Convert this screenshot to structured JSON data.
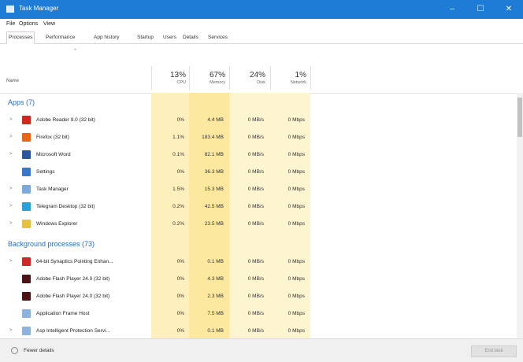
{
  "window": {
    "title": "Task Manager",
    "minimize": "–",
    "maximize": "☐",
    "close": "✕"
  },
  "menu": [
    "File",
    "Options",
    "View"
  ],
  "tabs": [
    "Processes",
    "Performance",
    "App history",
    "Startup",
    "Users",
    "Details",
    "Services"
  ],
  "header": {
    "sort_caret": "^",
    "name": "Name",
    "cpu": {
      "pct": "13%",
      "label": "CPU"
    },
    "memory": {
      "pct": "67%",
      "label": "Memory"
    },
    "disk": {
      "pct": "24%",
      "label": "Disk"
    },
    "network": {
      "pct": "1%",
      "label": "Network"
    }
  },
  "groups": {
    "apps": "Apps (7)",
    "background": "Background processes (73)"
  },
  "apps": [
    {
      "name": "Adobe Reader 9.0 (32 bit)",
      "cpu": "0%",
      "mem": "4.4 MB",
      "disk": "0 MB/s",
      "net": "0 Mbps",
      "icon": "reader-icon",
      "color": "#cc2a1e",
      "expandable": true
    },
    {
      "name": "Firefox (32 bit)",
      "cpu": "1.1%",
      "mem": "183.4 MB",
      "disk": "0 MB/s",
      "net": "0 Mbps",
      "icon": "firefox-icon",
      "color": "#e5671a",
      "expandable": true
    },
    {
      "name": "Microsoft Word",
      "cpu": "0.1%",
      "mem": "82.1 MB",
      "disk": "0 MB/s",
      "net": "0 Mbps",
      "icon": "word-icon",
      "color": "#2b579a",
      "expandable": true
    },
    {
      "name": "Settings",
      "cpu": "0%",
      "mem": "36.3 MB",
      "disk": "0 MB/s",
      "net": "0 Mbps",
      "icon": "settings-icon",
      "color": "#3a78c9",
      "expandable": false
    },
    {
      "name": "Task Manager",
      "cpu": "1.5%",
      "mem": "15.3 MB",
      "disk": "0 MB/s",
      "net": "0 Mbps",
      "icon": "task-manager-icon",
      "color": "#7fa9d6",
      "expandable": true
    },
    {
      "name": "Telegram Desktop (32 bit)",
      "cpu": "0.2%",
      "mem": "42.5 MB",
      "disk": "0 MB/s",
      "net": "0 Mbps",
      "icon": "telegram-icon",
      "color": "#2ea0d8",
      "expandable": true
    },
    {
      "name": "Windows Explorer",
      "cpu": "0.2%",
      "mem": "23.5 MB",
      "disk": "0 MB/s",
      "net": "0 Mbps",
      "icon": "folder-icon",
      "color": "#e8c042",
      "expandable": true
    }
  ],
  "background": [
    {
      "name": "64-bit Synaptics Pointing Enhan...",
      "cpu": "0%",
      "mem": "0.1 MB",
      "disk": "0 MB/s",
      "net": "0 Mbps",
      "icon": "synaptics-icon",
      "color": "#cc2a2a",
      "expandable": true
    },
    {
      "name": "Adobe Flash Player 24.0 (32 bit)",
      "cpu": "0%",
      "mem": "4.3 MB",
      "disk": "0 MB/s",
      "net": "0 Mbps",
      "icon": "flash-icon",
      "color": "#4a1416",
      "expandable": false
    },
    {
      "name": "Adobe Flash Player 24.0 (32 bit)",
      "cpu": "0%",
      "mem": "2.3 MB",
      "disk": "0 MB/s",
      "net": "0 Mbps",
      "icon": "flash-icon",
      "color": "#4a1416",
      "expandable": false
    },
    {
      "name": "Application Frame Host",
      "cpu": "0%",
      "mem": "7.5 MB",
      "disk": "0 MB/s",
      "net": "0 Mbps",
      "icon": "app-frame-icon",
      "color": "#8fb3dc",
      "expandable": false
    },
    {
      "name": "Asp Intelligent Protection Servi...",
      "cpu": "0%",
      "mem": "0.1 MB",
      "disk": "0 MB/s",
      "net": "0 Mbps",
      "icon": "service-icon",
      "color": "#8fb3dc",
      "expandable": true
    }
  ],
  "status": {
    "fewer_details": "Fewer details",
    "end_task": "End task"
  }
}
